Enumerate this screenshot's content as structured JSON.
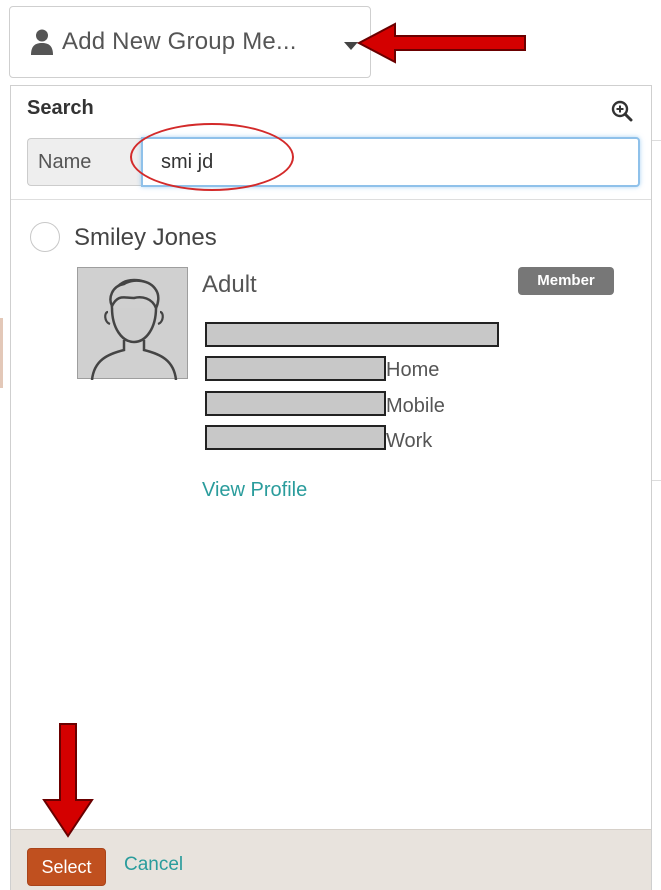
{
  "trigger": {
    "icon": "user-icon",
    "label": "Add New Group Me...",
    "caret_icon": "caret-down-icon"
  },
  "search": {
    "title": "Search",
    "zoom_icon": "zoom-in-icon",
    "field_label": "Name",
    "field_value": "smi jd"
  },
  "result": {
    "name": "Smiley Jones",
    "age_group": "Adult",
    "badge": "Member",
    "avatar_icon": "person-silhouette-icon",
    "phones": [
      {
        "label": "Home"
      },
      {
        "label": "Mobile"
      },
      {
        "label": "Work"
      }
    ],
    "view_profile": "View Profile"
  },
  "footer": {
    "select_label": "Select",
    "cancel_label": "Cancel"
  },
  "colors": {
    "select_button": "#c0501f",
    "link": "#2a9c9c",
    "badge": "#777777",
    "annotation": "#d32a2a",
    "input_focus": "#8fc1ea"
  }
}
